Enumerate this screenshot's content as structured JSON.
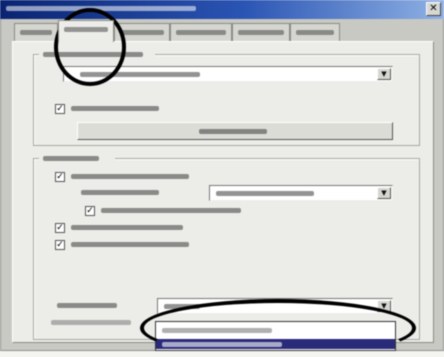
{
  "window": {
    "title": ""
  },
  "tabs": [
    {
      "label": ""
    },
    {
      "label": ""
    },
    {
      "label": ""
    },
    {
      "label": ""
    },
    {
      "label": ""
    },
    {
      "label": ""
    }
  ],
  "midi_group": {
    "label": "",
    "device_value": "",
    "lock_label": "",
    "add_button": ""
  },
  "config_group": {
    "label": "",
    "legacy_label": "",
    "mpu_label": "",
    "mpu_value": "",
    "allow_label": "",
    "joystick_label": "",
    "wave_label": "",
    "output_label": "",
    "output_value": ""
  },
  "dropdown": {
    "items": [
      "",
      ""
    ]
  },
  "colors": {
    "title_gradient_start": "#0a2472",
    "title_gradient_end": "#8fb1e4",
    "selection": "#2a2a7a",
    "annotation": "#000000"
  }
}
